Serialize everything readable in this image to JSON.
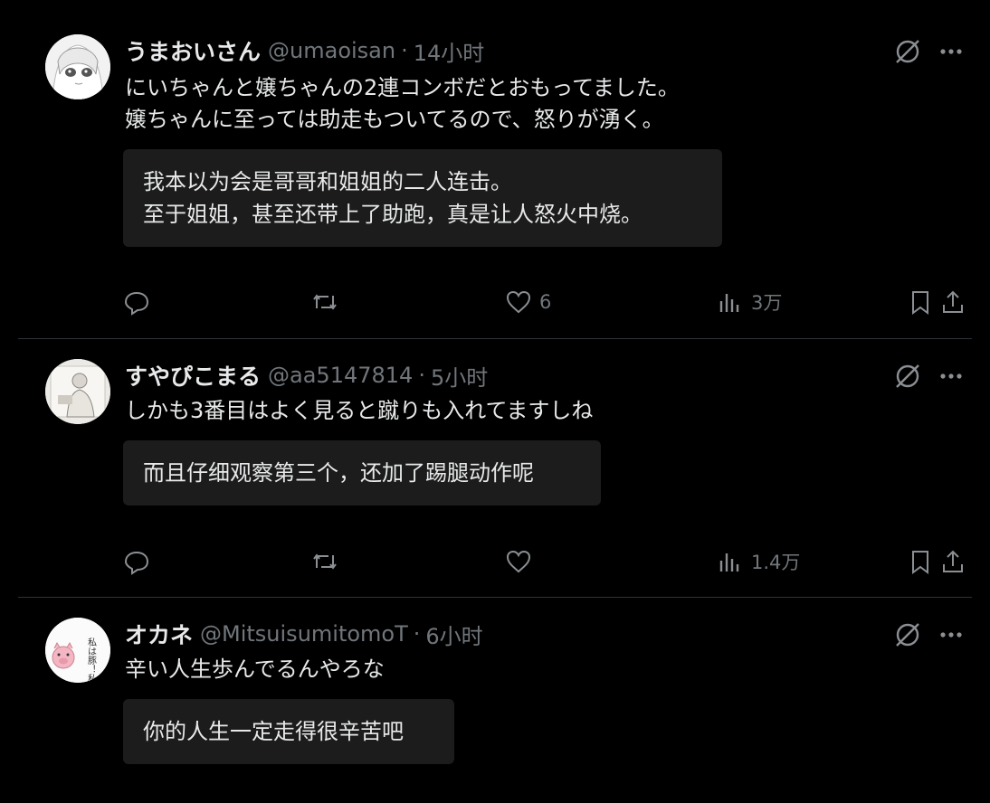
{
  "tweets": [
    {
      "name": "うまおいさん",
      "handle": "@umaoisan",
      "sep": "·",
      "time": "14小时",
      "text_lines": [
        "にいちゃんと嬢ちゃんの2連コンボだとおもってました。",
        "嬢ちゃんに至っては助走もついてるので、怒りが湧く。"
      ],
      "translation_lines": [
        "我本以为会是哥哥和姐姐的二人连击。",
        "至于姐姐，甚至还带上了助跑，真是让人怒火中烧。"
      ],
      "likes": "6",
      "views": "3万"
    },
    {
      "name": "すやぴこまる",
      "handle": "@aa5147814",
      "sep": "·",
      "time": "5小时",
      "text_lines": [
        "しかも3番目はよく見ると蹴りも入れてますしね"
      ],
      "translation_lines": [
        "而且仔细观察第三个，还加了踢腿动作呢"
      ],
      "likes": "",
      "views": "1.4万"
    },
    {
      "name": "オカネ",
      "handle": "@MitsuisumitomoT",
      "sep": "·",
      "time": "6小时",
      "text_lines": [
        "辛い人生歩んでるんやろな"
      ],
      "translation_lines": [
        "你的人生一定走得很辛苦吧"
      ],
      "likes": "",
      "views": ""
    }
  ],
  "avatar3_text": "私は豚！私は豚！",
  "icons": {
    "reply": "reply-icon",
    "retweet": "retweet-icon",
    "like": "heart-icon",
    "views": "views-icon",
    "bookmark": "bookmark-icon",
    "share": "share-icon",
    "grok": "grok-icon",
    "more": "more-icon"
  },
  "colors": {
    "background": "#000000",
    "text": "#e7e9ea",
    "muted": "#71767b",
    "translation_bg": "#1c1c1c",
    "divider": "#2f3336"
  }
}
